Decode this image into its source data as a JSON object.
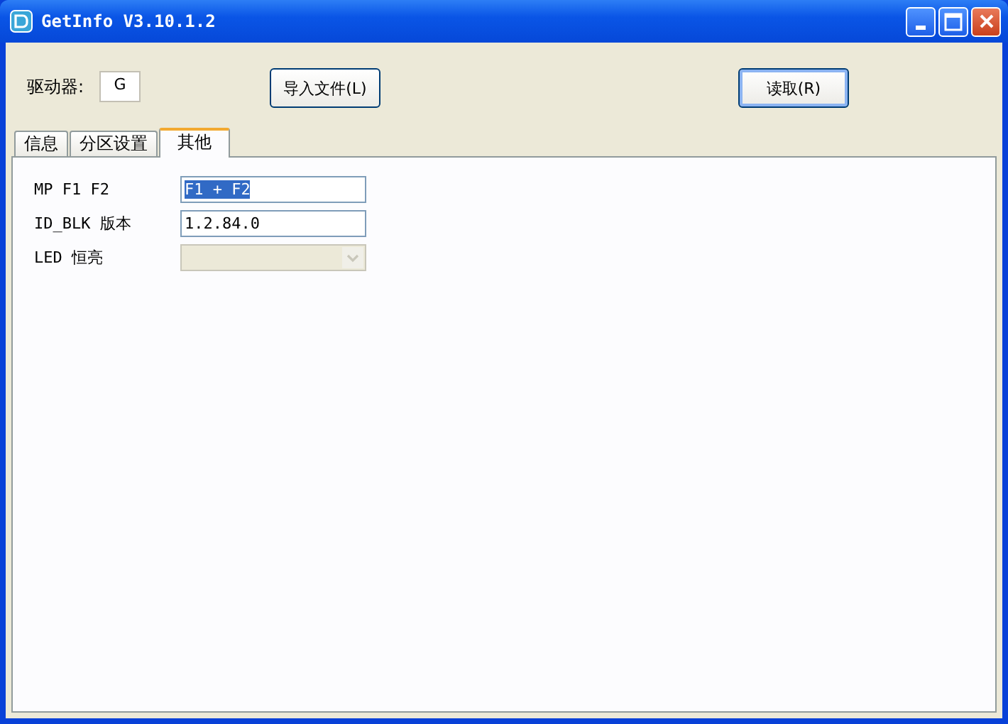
{
  "window": {
    "title": "GetInfo V3.10.1.2"
  },
  "drive": {
    "label": "驱动器:",
    "value": "G"
  },
  "buttons": [
    {
      "label": "导入文件(L)",
      "default": false
    },
    {
      "label": "读取(R)",
      "default": true
    }
  ],
  "tabs": [
    {
      "label": "信息",
      "selected": false
    },
    {
      "label": "分区设置",
      "selected": false
    },
    {
      "label": "其他",
      "selected": true
    }
  ],
  "fields": [
    {
      "kind": "text",
      "label": "MP F1 F2",
      "value": "F1 + F2",
      "text_selected": true
    },
    {
      "kind": "text",
      "label": "ID_BLK 版本",
      "value": "1.2.84.0",
      "text_selected": false
    },
    {
      "kind": "dropdown",
      "label": "LED 恒亮",
      "disabled": true
    }
  ]
}
